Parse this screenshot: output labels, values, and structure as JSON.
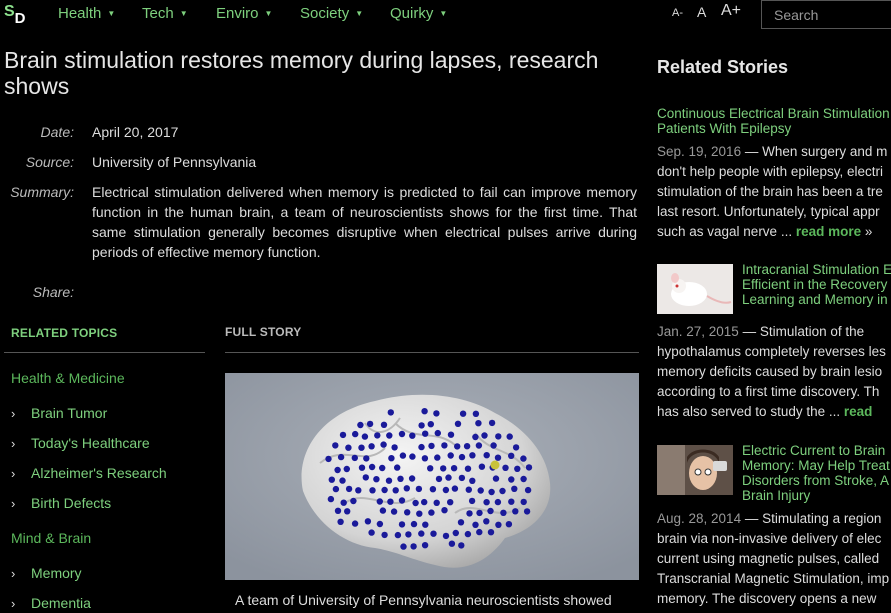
{
  "nav": {
    "logo_s": "S",
    "logo_d": "D",
    "items": [
      {
        "label": "Health"
      },
      {
        "label": "Tech"
      },
      {
        "label": "Enviro"
      },
      {
        "label": "Society"
      },
      {
        "label": "Quirky"
      }
    ],
    "font_small": "A-",
    "font_normal": "A",
    "font_large": "A+",
    "search_placeholder": "Search"
  },
  "article": {
    "headline": "Brain stimulation restores memory during lapses, research shows",
    "date_label": "Date:",
    "date": "April 20, 2017",
    "source_label": "Source:",
    "source": "University of Pennsylvania",
    "summary_label": "Summary:",
    "summary": "Electrical stimulation delivered when memory is predicted to fail can improve memory function in the human brain, a team of neuroscientists shows for the first time. That same stimulation generally becomes disruptive when electrical pulses arrive during periods of effective memory function.",
    "share_label": "Share:",
    "full_story_label": "FULL STORY",
    "caption": "A team of University of Pennsylvania neuroscientists showed"
  },
  "topics": {
    "heading": "RELATED TOPICS",
    "categories": [
      {
        "name": "Health & Medicine",
        "items": [
          "Brain Tumor",
          "Today's Healthcare",
          "Alzheimer's Research",
          "Birth Defects"
        ]
      },
      {
        "name": "Mind & Brain",
        "items": [
          "Memory",
          "Dementia"
        ]
      }
    ]
  },
  "related": {
    "heading": "Related Stories",
    "stories": [
      {
        "title_lines": [
          "Continuous Electrical Brain Stimulation",
          "Patients With Epilepsy"
        ],
        "date": "Sep. 19, 2016",
        "body_lines": [
          " — When surgery and m",
          "don't help people with epilepsy, electri",
          "stimulation of the brain has been a tre",
          "last resort. Unfortunately, typical appr",
          "such as vagal nerve ... "
        ],
        "more": "read more"
      },
      {
        "title_lines": [
          "Intracranial Stimulation E",
          "Efficient in the Recovery",
          "Learning and Memory in"
        ],
        "date": "Jan. 27, 2015",
        "body_lines": [
          " — Stimulation of the",
          "hypothalamus completely reverses les",
          "memory deficits caused by brain lesio",
          "according to a first time discovery. Th",
          "has also served to study the ... "
        ],
        "more": "read"
      },
      {
        "title_lines": [
          "Electric Current to Brain",
          "Memory: May Help Treat",
          "Disorders from Stroke, A",
          "Brain Injury"
        ],
        "date": "Aug. 28, 2014",
        "body_lines": [
          " — Stimulating a region",
          "brain via non-invasive delivery of elec",
          "current using magnetic pulses, called",
          "Transcranial Magnetic Stimulation, imp",
          "memory. The discovery opens a new"
        ]
      }
    ]
  },
  "colors": {
    "accent": "#7ed07e",
    "category": "#5cb85c",
    "background": "#000000"
  }
}
